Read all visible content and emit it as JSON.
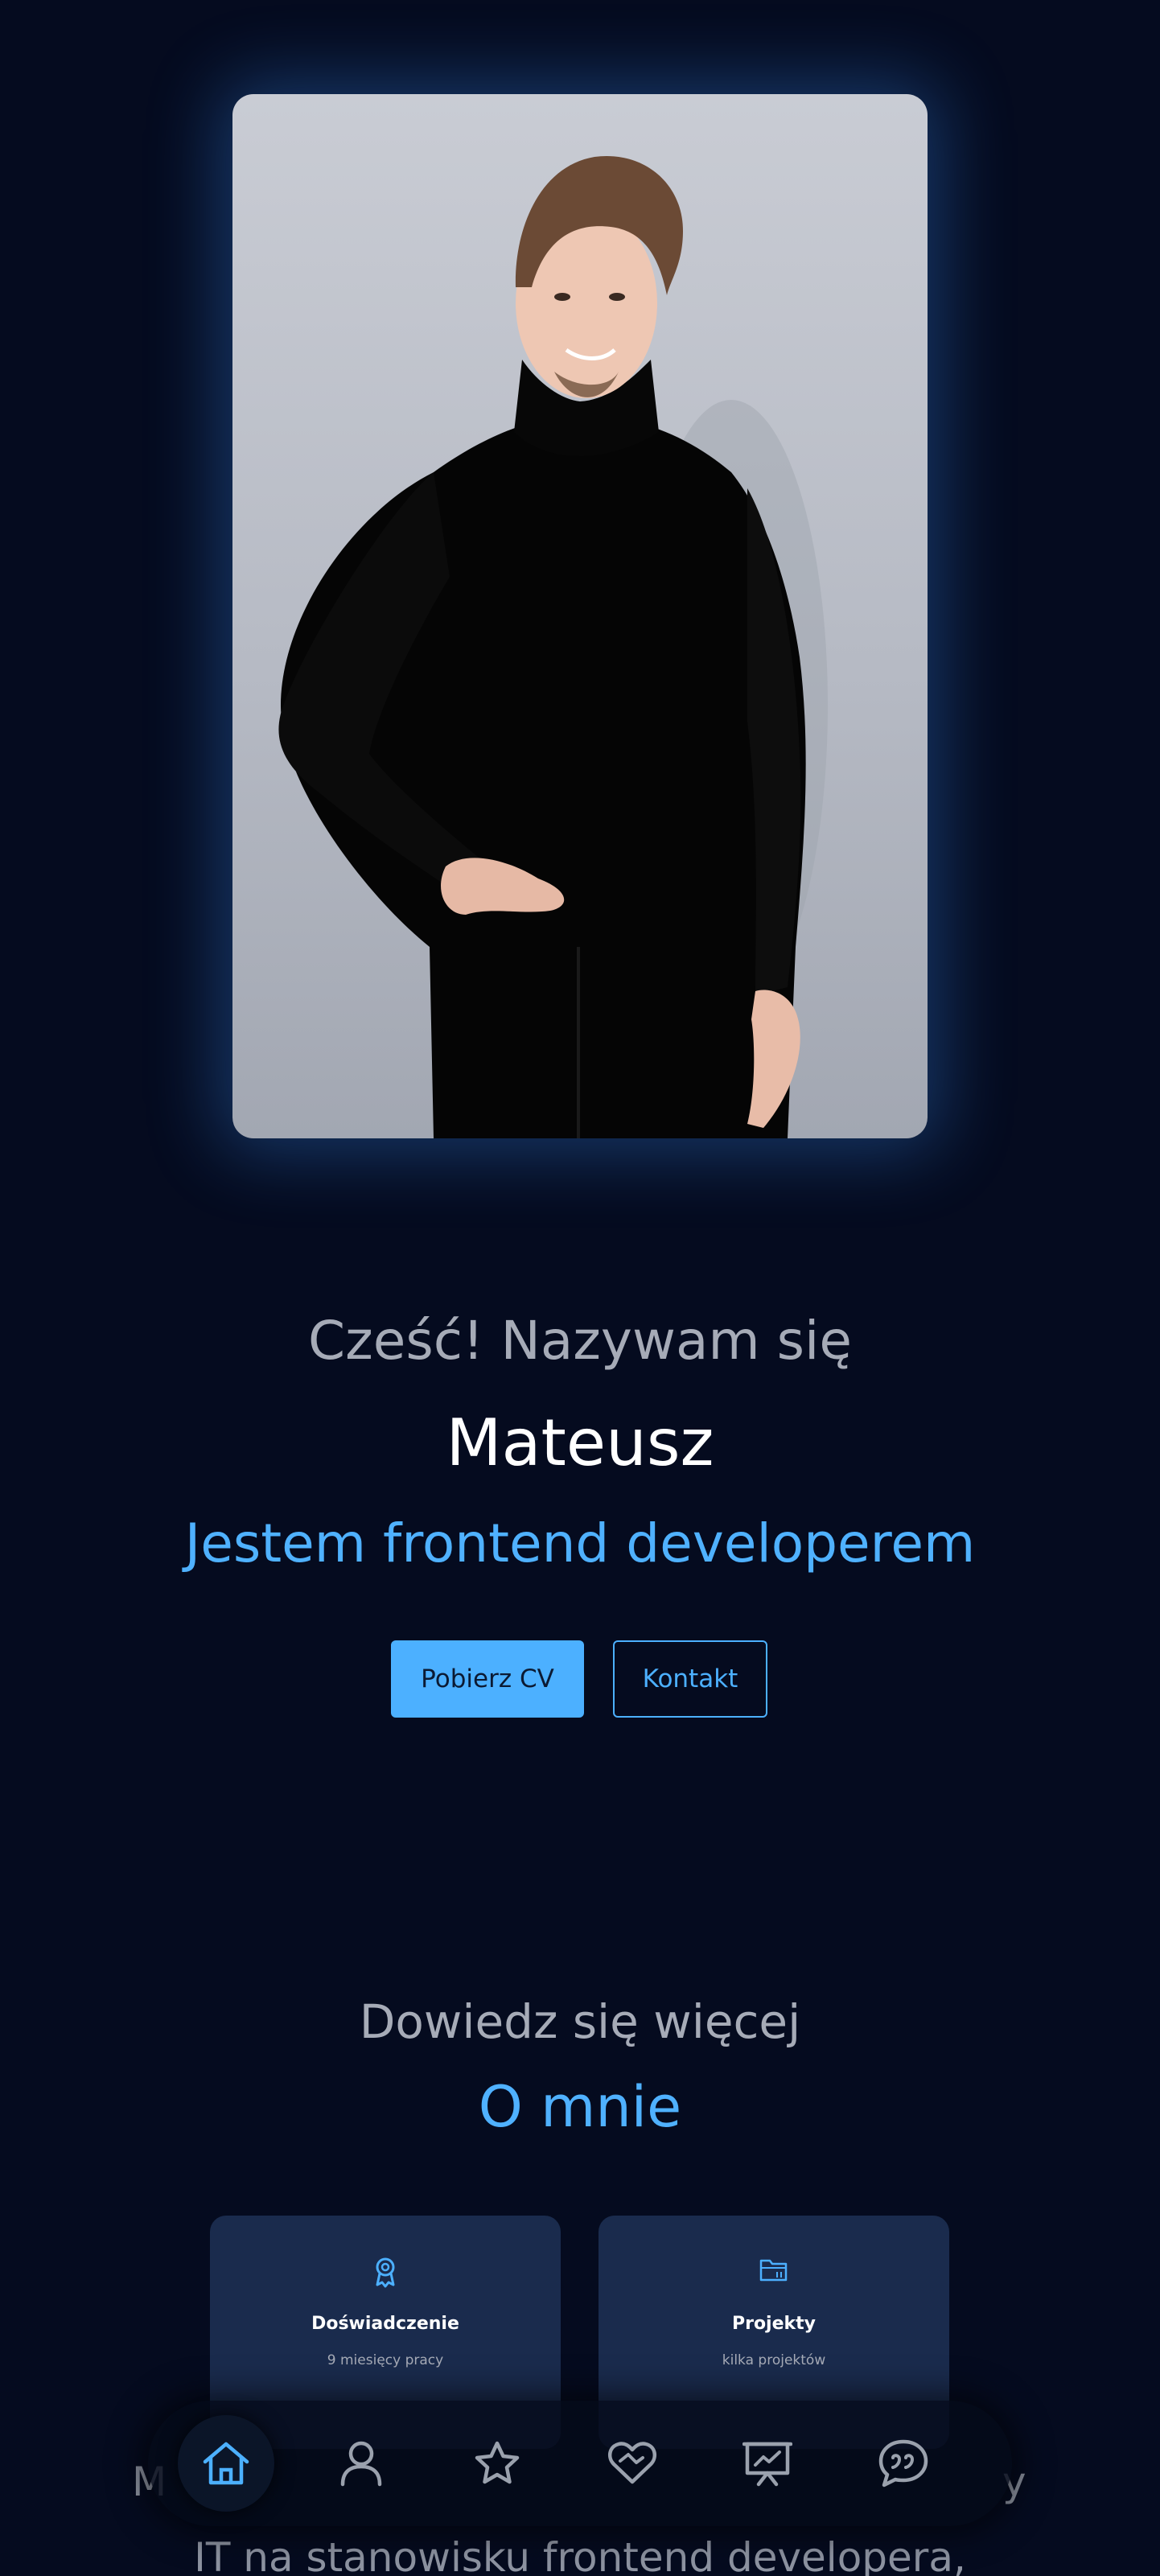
{
  "hero": {
    "greeting": "Cześć! Nazywam się",
    "name": "Mateusz",
    "role": "Jestem frontend developerem",
    "download_cv_label": "Pobierz CV",
    "contact_label": "Kontakt"
  },
  "about": {
    "subtitle": "Dowiedz się więcej",
    "title": "O mnie",
    "cards": [
      {
        "icon": "award-icon",
        "title": "Doświadczenie",
        "text": "9 miesięcy pracy"
      },
      {
        "icon": "folder-icon",
        "title": "Projekty",
        "text": "kilka projektów"
      }
    ],
    "paragraph_line_1_start": "M",
    "paragraph_line_1_end": "y",
    "paragraph_line_2": "IT na stanowisku frontend developera,"
  },
  "nav": {
    "items": [
      {
        "icon": "home-icon",
        "active": true
      },
      {
        "icon": "user-icon",
        "active": false
      },
      {
        "icon": "star-icon",
        "active": false
      },
      {
        "icon": "handshake-heart-icon",
        "active": false
      },
      {
        "icon": "presentation-icon",
        "active": false
      },
      {
        "icon": "chat-quote-icon",
        "active": false
      }
    ]
  },
  "colors": {
    "background": "#050b1f",
    "accent": "#4cb0ff",
    "muted_text": "#a6abb7",
    "card": "#1a2b4d"
  }
}
